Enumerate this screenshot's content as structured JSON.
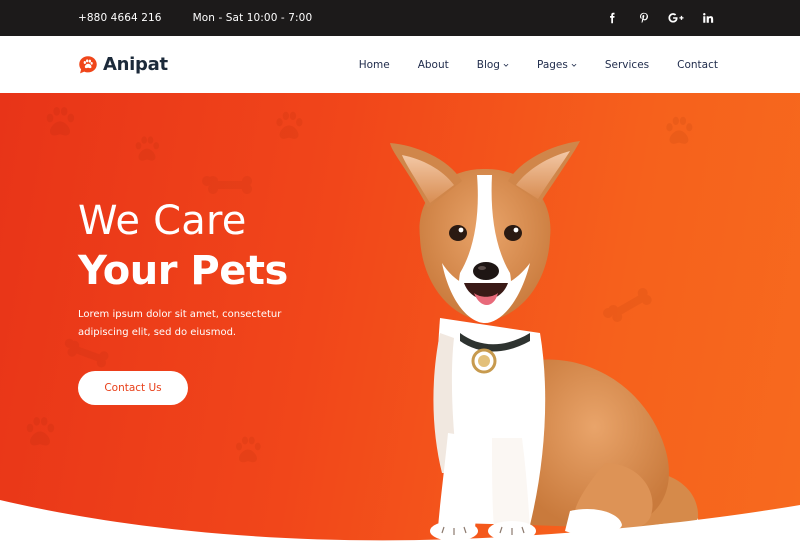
{
  "topbar": {
    "phone": "+880 4664 216",
    "hours": "Mon - Sat 10:00 - 7:00",
    "social": [
      {
        "icon": "facebook-icon",
        "glyph": "f"
      },
      {
        "icon": "pinterest-icon",
        "glyph": "P"
      },
      {
        "icon": "google-plus-icon",
        "glyph": "G+"
      },
      {
        "icon": "linkedin-icon",
        "glyph": "in"
      }
    ]
  },
  "header": {
    "brand": "Anipat",
    "nav": {
      "home": "Home",
      "about": "About",
      "blog": "Blog",
      "pages": "Pages",
      "services": "Services",
      "contact": "Contact"
    }
  },
  "hero": {
    "title_line1": "We Care",
    "title_line2": "Your Pets",
    "description": "Lorem ipsum dolor sit amet, consectetur adipiscing elit, sed do eiusmod.",
    "cta_label": "Contact Us",
    "image": "corgi-puppy-image"
  },
  "colors": {
    "topbar_bg": "#1c1a1a",
    "accent": "#f0461a",
    "nav_text": "#1e2a4a",
    "brand_text": "#1c2a3a"
  }
}
